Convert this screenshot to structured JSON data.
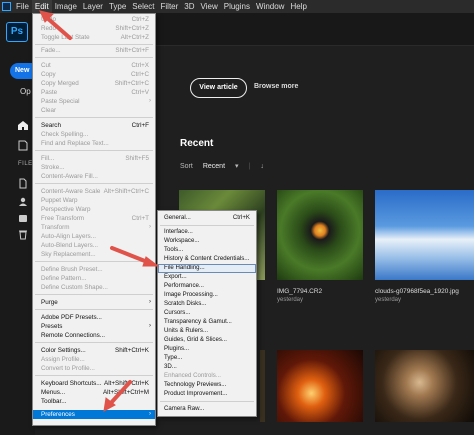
{
  "menubar": {
    "items": [
      {
        "label": "File"
      },
      {
        "label": "Edit"
      },
      {
        "label": "Image"
      },
      {
        "label": "Layer"
      },
      {
        "label": "Type"
      },
      {
        "label": "Select"
      },
      {
        "label": "Filter"
      },
      {
        "label": "3D"
      },
      {
        "label": "View"
      },
      {
        "label": "Plugins"
      },
      {
        "label": "Window"
      },
      {
        "label": "Help"
      }
    ]
  },
  "left": {
    "logo": "Ps",
    "new_label": "New",
    "open_label": "Op",
    "files_label": "FILE"
  },
  "home": {
    "view_article": "View article",
    "browse_more": "Browse more",
    "recent_title": "Recent",
    "sort_label": "Sort",
    "sort_value": "Recent",
    "recent_files": [
      {
        "name": "",
        "sub": ""
      },
      {
        "name": "IMG_7794.CR2",
        "sub": "yesterday"
      },
      {
        "name": "clouds-g07968f5ea_1920.jpg",
        "sub": "yesterday"
      }
    ]
  },
  "edit_menu": {
    "items": [
      {
        "label": "Undo",
        "shortcut": "Ctrl+Z"
      },
      {
        "label": "Redo",
        "shortcut": "Shift+Ctrl+Z"
      },
      {
        "label": "Toggle Last State",
        "shortcut": "Alt+Ctrl+Z"
      },
      {
        "label": "Fade...",
        "shortcut": "Shift+Ctrl+F"
      },
      {
        "label": "Cut",
        "shortcut": "Ctrl+X"
      },
      {
        "label": "Copy",
        "shortcut": "Ctrl+C"
      },
      {
        "label": "Copy Merged",
        "shortcut": "Shift+Ctrl+C"
      },
      {
        "label": "Paste",
        "shortcut": "Ctrl+V"
      },
      {
        "label": "Paste Special",
        "shortcut": ""
      },
      {
        "label": "Clear",
        "shortcut": ""
      },
      {
        "label": "Search",
        "shortcut": "Ctrl+F"
      },
      {
        "label": "Check Spelling...",
        "shortcut": ""
      },
      {
        "label": "Find and Replace Text...",
        "shortcut": ""
      },
      {
        "label": "Fill...",
        "shortcut": "Shift+F5"
      },
      {
        "label": "Stroke...",
        "shortcut": ""
      },
      {
        "label": "Content-Aware Fill...",
        "shortcut": ""
      },
      {
        "label": "Content-Aware Scale",
        "shortcut": "Alt+Shift+Ctrl+C"
      },
      {
        "label": "Puppet Warp",
        "shortcut": ""
      },
      {
        "label": "Perspective Warp",
        "shortcut": ""
      },
      {
        "label": "Free Transform",
        "shortcut": "Ctrl+T"
      },
      {
        "label": "Transform",
        "shortcut": ""
      },
      {
        "label": "Auto-Align Layers...",
        "shortcut": ""
      },
      {
        "label": "Auto-Blend Layers...",
        "shortcut": ""
      },
      {
        "label": "Sky Replacement...",
        "shortcut": ""
      },
      {
        "label": "Define Brush Preset...",
        "shortcut": ""
      },
      {
        "label": "Define Pattern...",
        "shortcut": ""
      },
      {
        "label": "Define Custom Shape...",
        "shortcut": ""
      },
      {
        "label": "Purge",
        "shortcut": ""
      },
      {
        "label": "Adobe PDF Presets...",
        "shortcut": ""
      },
      {
        "label": "Presets",
        "shortcut": ""
      },
      {
        "label": "Remote Connections...",
        "shortcut": ""
      },
      {
        "label": "Color Settings...",
        "shortcut": "Shift+Ctrl+K"
      },
      {
        "label": "Assign Profile...",
        "shortcut": ""
      },
      {
        "label": "Convert to Profile...",
        "shortcut": ""
      },
      {
        "label": "Keyboard Shortcuts...",
        "shortcut": "Alt+Shift+Ctrl+K"
      },
      {
        "label": "Menus...",
        "shortcut": "Alt+Shift+Ctrl+M"
      },
      {
        "label": "Toolbar...",
        "shortcut": ""
      },
      {
        "label": "Preferences",
        "shortcut": ""
      }
    ]
  },
  "pref_menu": {
    "items": [
      {
        "label": "General...",
        "shortcut": "Ctrl+K"
      },
      {
        "label": "Interface...",
        "shortcut": ""
      },
      {
        "label": "Workspace...",
        "shortcut": ""
      },
      {
        "label": "Tools...",
        "shortcut": ""
      },
      {
        "label": "History & Content Credentials...",
        "shortcut": ""
      },
      {
        "label": "File Handling...",
        "shortcut": ""
      },
      {
        "label": "Export...",
        "shortcut": ""
      },
      {
        "label": "Performance...",
        "shortcut": ""
      },
      {
        "label": "Image Processing...",
        "shortcut": ""
      },
      {
        "label": "Scratch Disks...",
        "shortcut": ""
      },
      {
        "label": "Cursors...",
        "shortcut": ""
      },
      {
        "label": "Transparency & Gamut...",
        "shortcut": ""
      },
      {
        "label": "Units & Rulers...",
        "shortcut": ""
      },
      {
        "label": "Guides, Grid & Slices...",
        "shortcut": ""
      },
      {
        "label": "Plugins...",
        "shortcut": ""
      },
      {
        "label": "Type...",
        "shortcut": ""
      },
      {
        "label": "3D...",
        "shortcut": ""
      },
      {
        "label": "Enhanced Controls...",
        "shortcut": ""
      },
      {
        "label": "Technology Previews...",
        "shortcut": ""
      },
      {
        "label": "Product Improvement...",
        "shortcut": ""
      },
      {
        "label": "Camera Raw...",
        "shortcut": ""
      }
    ]
  },
  "colors": {
    "accent": "#0078d7",
    "ps_blue": "#31a8ff",
    "annotation_red": "#e0534a"
  }
}
